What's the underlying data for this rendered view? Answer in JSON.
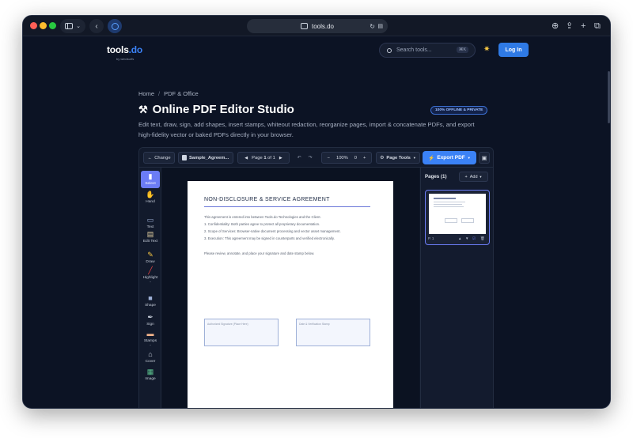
{
  "browser": {
    "url": "tools.do",
    "traffic_colors": [
      "#ff5f57",
      "#febc2e",
      "#28c840"
    ]
  },
  "site": {
    "logo": "tools",
    "logo_ext": ".do",
    "logo_sub": "by windsurfs",
    "search_placeholder": "Search tools...",
    "search_shortcut": "⌘K",
    "login_label": "Log In"
  },
  "breadcrumb": {
    "home": "Home",
    "separator": "/",
    "section": "PDF & Office"
  },
  "page": {
    "title": "Online PDF Editor Studio",
    "badge": "100% OFFLINE & PRIVATE",
    "description": "Edit text, draw, sign, add shapes, insert stamps, whiteout redaction, reorganize pages, import & concatenate PDFs, and export high-fidelity vector or baked PDFs directly in your browser."
  },
  "toolbar": {
    "change_label": "Change",
    "file_name": "Sample_Agreem...",
    "page_prefix": "Page",
    "page_current": "1",
    "page_of": "of 1",
    "zoom": "100%",
    "rotation": "0",
    "page_tools_label": "Page Tools",
    "export_label": "Export PDF"
  },
  "tools": [
    {
      "label": "Select",
      "icon": "cursor-icon"
    },
    {
      "label": "Hand",
      "icon": "hand-icon"
    },
    {
      "label": "Text",
      "icon": "text-icon"
    },
    {
      "label": "Edit Text",
      "icon": "edit-text-icon"
    },
    {
      "label": "Draw",
      "icon": "draw-icon"
    },
    {
      "label": "Highlight",
      "icon": "highlight-icon"
    },
    {
      "label": "Shape",
      "icon": "shape-icon"
    },
    {
      "label": "Sign",
      "icon": "sign-icon"
    },
    {
      "label": "Stamps",
      "icon": "stamp-icon"
    },
    {
      "label": "Cover",
      "icon": "cover-icon"
    },
    {
      "label": "Image",
      "icon": "image-icon"
    }
  ],
  "document": {
    "title": "NON-DISCLOSURE & SERVICE AGREEMENT",
    "lines": [
      "This agreement is entered into between Tools.do Technologies and the Client.",
      "1. Confidentiality: Both parties agree to protect all proprietary documentation.",
      "2. Scope of Services: Browser-native document processing and vector asset management.",
      "3. Execution: This agreement may be signed in counterparts and verified electronically.",
      "Please review, annotate, and place your signature and date stamp below."
    ],
    "signature_box": "Authorized Signature (Place Here)",
    "date_box": "Date & Verification Stamp"
  },
  "pages_panel": {
    "title": "Pages (1)",
    "add_label": "Add",
    "thumb_label": "P. 1"
  }
}
